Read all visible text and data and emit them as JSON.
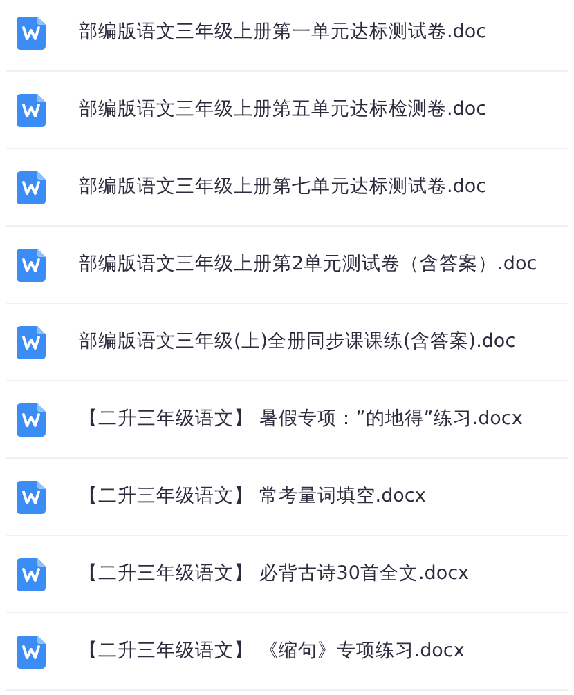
{
  "files": [
    {
      "name": "部编版语文三年级上册第一单元达标测试卷.doc"
    },
    {
      "name": "部编版语文三年级上册第五单元达标检测卷.doc"
    },
    {
      "name": "部编版语文三年级上册第七单元达标测试卷.doc"
    },
    {
      "name": "部编版语文三年级上册第2单元测试卷（含答案）.doc"
    },
    {
      "name": "部编版语文三年级(上)全册同步课课练(含答案).doc"
    },
    {
      "name": "【二升三年级语文】 暑假专项：”的地得”练习.docx"
    },
    {
      "name": "【二升三年级语文】 常考量词填空.docx"
    },
    {
      "name": "【二升三年级语文】 必背古诗30首全文.docx"
    },
    {
      "name": "【二升三年级语文】 《缩句》专项练习.docx"
    }
  ]
}
